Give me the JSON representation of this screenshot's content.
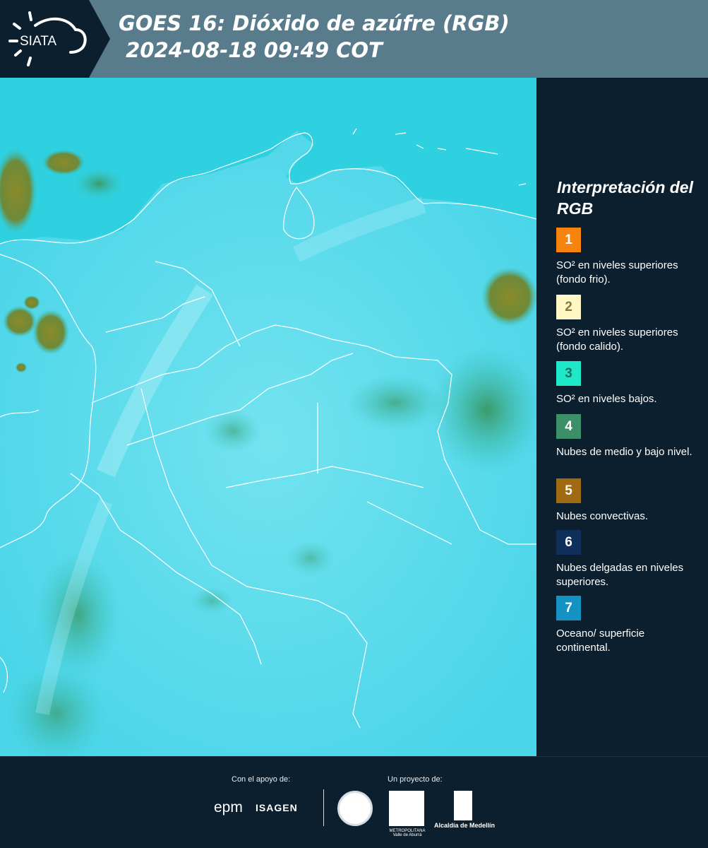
{
  "header": {
    "logo_text": "SIATA",
    "title_line1": "GOES 16: Dióxido de azúfre (RGB)",
    "title_line2": " 2024-08-18 09:49 COT"
  },
  "legend": {
    "title": "Interpretación del RGB",
    "items": [
      {
        "number": "1",
        "color": "#f7830f",
        "label": "SO² en niveles superiores (fondo frio)."
      },
      {
        "number": "2",
        "color": "#fff7c4",
        "label": "SO² en niveles superiores (fondo calido)."
      },
      {
        "number": "3",
        "color": "#1fe8c8",
        "label": "SO² en niveles bajos."
      },
      {
        "number": "4",
        "color": "#3b8f69",
        "label": "Nubes de medio y bajo nivel."
      },
      {
        "number": "5",
        "color": "#a06a12",
        "label": "Nubes convectivas."
      },
      {
        "number": "6",
        "color": "#10305c",
        "label": "Nubes delgadas en niveles superiores."
      },
      {
        "number": "7",
        "color": "#1492c4",
        "label": "Oceano/ superficie continental."
      }
    ]
  },
  "footer": {
    "support_label": "Con el apoyo de:",
    "project_label": "Un proyecto de:",
    "epm": "epm",
    "isagen": "ISAGEN",
    "metro": "METROPOLITANA Valle de Aburrá",
    "alcaldia": "Alcaldía de Medellín"
  },
  "colors": {
    "background": "#0c1f2e",
    "header": "#587c8b",
    "ocean": "#2fd0e0",
    "land": "#5ad7ea"
  }
}
